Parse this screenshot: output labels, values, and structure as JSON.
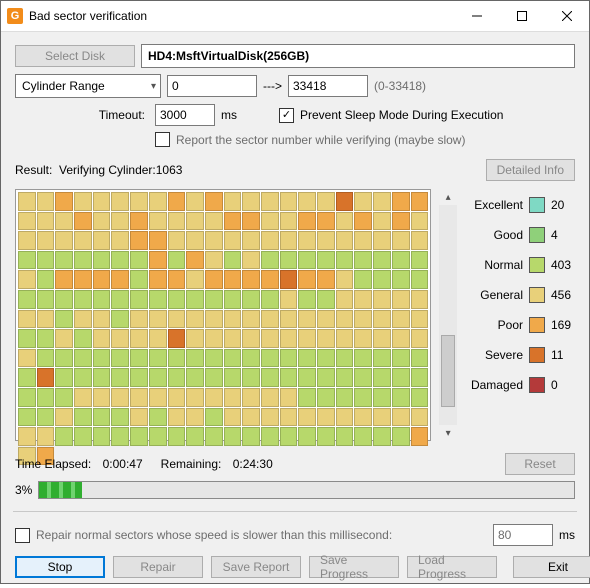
{
  "window": {
    "title": "Bad sector verification"
  },
  "disk": {
    "select_label": "Select Disk",
    "name": "HD4:MsftVirtualDisk(256GB)"
  },
  "range": {
    "label": "Cylinder Range",
    "from": "0",
    "to": "33418",
    "hint": "(0-33418)",
    "arrow": "--->"
  },
  "timeout": {
    "label": "Timeout:",
    "value": "3000",
    "unit": "ms"
  },
  "options": {
    "prevent_sleep": "Prevent Sleep Mode During Execution",
    "report_sector": "Report the sector number while verifying (maybe slow)"
  },
  "result": {
    "prefix": "Result:",
    "status": "Verifying Cylinder:1063",
    "detail_btn": "Detailed Info"
  },
  "legend": [
    {
      "name": "Excellent",
      "color": "#7fd9c4",
      "count": "20"
    },
    {
      "name": "Good",
      "color": "#8fd07a",
      "count": "4"
    },
    {
      "name": "Normal",
      "color": "#b7d86b",
      "count": "403"
    },
    {
      "name": "General",
      "color": "#e8d07a",
      "count": "456"
    },
    {
      "name": "Poor",
      "color": "#f0a94a",
      "count": "169"
    },
    {
      "name": "Severe",
      "color": "#d8732a",
      "count": "11"
    },
    {
      "name": "Damaged",
      "color": "#b43a3a",
      "count": "0"
    }
  ],
  "time": {
    "elapsed_label": "Time Elapsed:",
    "elapsed": "0:00:47",
    "remain_label": "Remaining:",
    "remain": "0:24:30",
    "reset": "Reset"
  },
  "progress": {
    "percent": "3%"
  },
  "repair": {
    "label": "Repair normal sectors whose speed is slower than this millisecond:",
    "value": "80",
    "unit": "ms"
  },
  "footer": {
    "stop": "Stop",
    "repair": "Repair",
    "save_report": "Save Report",
    "save_progress": "Save Progress",
    "load_progress": "Load Progress",
    "exit": "Exit"
  },
  "map_classes": [
    3,
    3,
    4,
    3,
    3,
    3,
    3,
    3,
    4,
    3,
    4,
    3,
    3,
    3,
    3,
    3,
    3,
    5,
    3,
    3,
    4,
    4,
    3,
    3,
    3,
    4,
    3,
    3,
    4,
    3,
    3,
    3,
    3,
    4,
    4,
    3,
    3,
    4,
    4,
    3,
    4,
    3,
    4,
    3,
    3,
    3,
    3,
    3,
    3,
    3,
    4,
    4,
    3,
    3,
    3,
    3,
    3,
    3,
    3,
    3,
    3,
    3,
    3,
    3,
    3,
    3,
    2,
    2,
    2,
    2,
    2,
    2,
    2,
    4,
    2,
    4,
    3,
    2,
    3,
    2,
    2,
    2,
    2,
    2,
    2,
    2,
    2,
    2,
    3,
    2,
    4,
    4,
    4,
    4,
    2,
    4,
    4,
    3,
    4,
    4,
    4,
    4,
    5,
    4,
    4,
    3,
    2,
    2,
    2,
    2,
    2,
    2,
    2,
    2,
    2,
    2,
    2,
    2,
    2,
    2,
    2,
    2,
    2,
    2,
    3,
    2,
    2,
    3,
    3,
    3,
    3,
    3,
    3,
    3,
    2,
    3,
    3,
    2,
    3,
    3,
    3,
    3,
    3,
    3,
    3,
    3,
    3,
    3,
    3,
    3,
    3,
    3,
    3,
    3,
    2,
    2,
    3,
    2,
    3,
    3,
    3,
    3,
    5,
    3,
    3,
    3,
    3,
    3,
    3,
    3,
    3,
    3,
    3,
    3,
    3,
    3,
    3,
    2,
    2,
    2,
    2,
    2,
    2,
    2,
    2,
    2,
    2,
    2,
    2,
    2,
    2,
    2,
    2,
    2,
    2,
    2,
    2,
    2,
    2,
    5,
    2,
    2,
    2,
    2,
    2,
    2,
    2,
    2,
    2,
    2,
    2,
    2,
    2,
    2,
    2,
    2,
    2,
    2,
    2,
    2,
    2,
    2,
    2,
    3,
    3,
    3,
    3,
    3,
    3,
    3,
    3,
    3,
    3,
    3,
    3,
    2,
    2,
    2,
    2,
    2,
    2,
    2,
    2,
    2,
    3,
    2,
    2,
    2,
    3,
    2,
    3,
    3,
    2,
    3,
    3,
    3,
    3,
    3,
    3,
    3,
    3,
    3,
    3,
    3,
    3,
    3,
    2,
    2,
    2,
    2,
    2,
    2,
    2,
    2,
    2,
    2,
    2,
    2,
    2,
    2,
    2,
    2,
    2,
    2,
    2,
    4,
    3,
    4
  ]
}
